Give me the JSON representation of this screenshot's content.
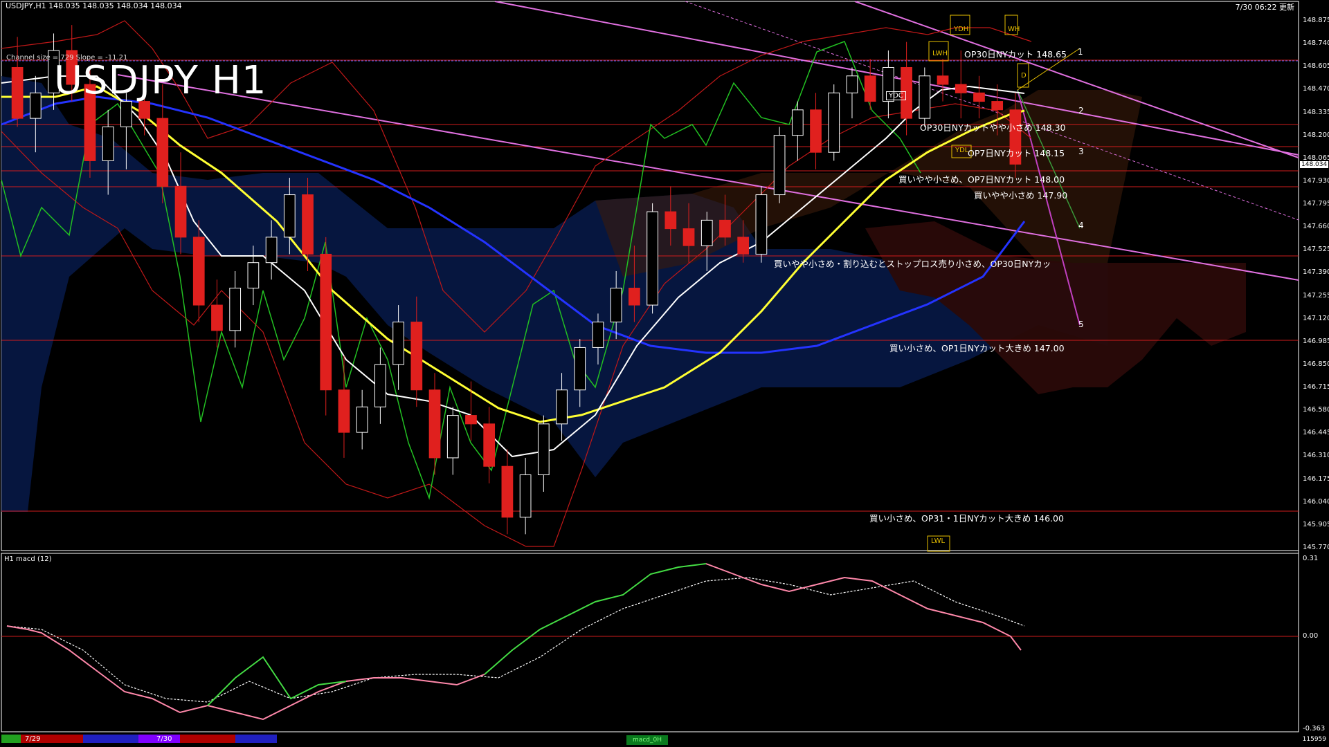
{
  "header": {
    "symbol_info": "USDJPY,H1  148.035 148.035 148.034 148.034",
    "datetime": "7/30 06:22 更新",
    "big_title": "USDJPY H1",
    "channel_info": "Channel size = 729 Slope = -11.21"
  },
  "macd_panel": {
    "title": "H1  macd (12)",
    "axis_labels": [
      "0.31",
      "0.00",
      "-0.363"
    ]
  },
  "bottom_bar": {
    "dates": [
      "7/29",
      "7/30"
    ],
    "tab_label": "macd_0H",
    "volume": "115959"
  },
  "yaxis": {
    "ticks": [
      "148.875",
      "148.740",
      "148.605",
      "148.470",
      "148.335",
      "148.200",
      "148.065",
      "147.930",
      "147.795",
      "147.660",
      "147.525",
      "147.390",
      "147.255",
      "147.120",
      "146.985",
      "146.850",
      "146.715",
      "146.580",
      "146.445",
      "146.310",
      "146.175",
      "146.040",
      "145.905",
      "145.770"
    ],
    "current_price": "148.034"
  },
  "levels": [
    {
      "text": "OP30日NYカット 148.65",
      "color": "#d01c1c"
    },
    {
      "text": "OP30日NYカットやや小さめ 148.30",
      "color": "#d01c1c"
    },
    {
      "text": "OP7日NYカット 148.15",
      "color": "#d01c1c"
    },
    {
      "text": "買いやや小さめ、OP7日NYカット 148.00",
      "color": "#d01c1c"
    },
    {
      "text": "買いやや小さめ 147.90",
      "color": "#d01c1c"
    },
    {
      "text": "買いやや小さめ・割り込むとストップロス売り小さめ、OP30日NYカッ",
      "color": "#d01c1c"
    },
    {
      "text": "買い小さめ、OP1日NYカット大きめ 147.00",
      "color": "#d01c1c"
    },
    {
      "text": "買い小さめ、OP31・1日NYカット大きめ 146.00",
      "color": "#d01c1c"
    }
  ],
  "channel_numbers": [
    "1",
    "2",
    "3",
    "4",
    "5"
  ],
  "boxes": [
    "YDH",
    "WH",
    "LWH",
    "D",
    "YDC",
    "YDL",
    "LWL"
  ],
  "colors": {
    "bull": "#ffffff",
    "bear": "#e0201e",
    "sma_white": "#ffffff",
    "sma_yellow": "#ffff33",
    "sma_blue": "#2433ff",
    "chikou": "#22c022",
    "bollinger": "#c01818",
    "channel": "#e070e0",
    "macd_up": "#44dd44",
    "macd_down": "#ff88aa"
  },
  "chart_data": {
    "type": "candlestick",
    "symbol": "USDJPY",
    "timeframe": "H1",
    "ylim": [
      145.77,
      148.875
    ],
    "candles": [
      [
        148.6,
        148.78,
        148.25,
        148.3
      ],
      [
        148.3,
        148.55,
        148.1,
        148.45
      ],
      [
        148.45,
        148.8,
        148.35,
        148.7
      ],
      [
        148.7,
        148.85,
        148.4,
        148.5
      ],
      [
        148.5,
        148.6,
        147.95,
        148.05
      ],
      [
        148.05,
        148.35,
        147.85,
        148.25
      ],
      [
        148.25,
        148.45,
        148.0,
        148.4
      ],
      [
        148.4,
        148.55,
        148.2,
        148.3
      ],
      [
        148.3,
        148.5,
        147.8,
        147.9
      ],
      [
        147.9,
        148.1,
        147.5,
        147.6
      ],
      [
        147.6,
        147.7,
        147.1,
        147.2
      ],
      [
        147.2,
        147.35,
        146.95,
        147.05
      ],
      [
        147.05,
        147.4,
        146.95,
        147.3
      ],
      [
        147.3,
        147.55,
        147.2,
        147.45
      ],
      [
        147.45,
        147.7,
        147.35,
        147.6
      ],
      [
        147.6,
        147.95,
        147.5,
        147.85
      ],
      [
        147.85,
        147.95,
        147.4,
        147.5
      ],
      [
        147.5,
        147.6,
        146.55,
        146.7
      ],
      [
        146.7,
        146.9,
        146.3,
        146.45
      ],
      [
        146.45,
        146.7,
        146.35,
        146.6
      ],
      [
        146.6,
        146.95,
        146.5,
        146.85
      ],
      [
        146.85,
        147.2,
        146.7,
        147.1
      ],
      [
        147.1,
        147.25,
        146.6,
        146.7
      ],
      [
        146.7,
        146.8,
        146.2,
        146.3
      ],
      [
        146.3,
        146.6,
        146.2,
        146.55
      ],
      [
        146.55,
        146.75,
        146.4,
        146.5
      ],
      [
        146.5,
        146.6,
        146.15,
        146.25
      ],
      [
        146.25,
        146.35,
        145.85,
        145.95
      ],
      [
        145.95,
        146.3,
        145.85,
        146.2
      ],
      [
        146.2,
        146.55,
        146.1,
        146.5
      ],
      [
        146.5,
        146.8,
        146.4,
        146.7
      ],
      [
        146.7,
        147.0,
        146.6,
        146.95
      ],
      [
        146.95,
        147.15,
        146.85,
        147.1
      ],
      [
        147.1,
        147.4,
        147.0,
        147.3
      ],
      [
        147.3,
        147.55,
        147.1,
        147.2
      ],
      [
        147.2,
        147.8,
        147.15,
        147.75
      ],
      [
        147.75,
        147.9,
        147.55,
        147.65
      ],
      [
        147.65,
        147.8,
        147.45,
        147.55
      ],
      [
        147.55,
        147.75,
        147.4,
        147.7
      ],
      [
        147.7,
        147.85,
        147.55,
        147.6
      ],
      [
        147.6,
        147.7,
        147.45,
        147.5
      ],
      [
        147.5,
        147.9,
        147.45,
        147.85
      ],
      [
        147.85,
        148.25,
        147.8,
        148.2
      ],
      [
        148.2,
        148.4,
        148.05,
        148.35
      ],
      [
        148.35,
        148.45,
        148.0,
        148.1
      ],
      [
        148.1,
        148.5,
        148.05,
        148.45
      ],
      [
        148.45,
        148.6,
        148.3,
        148.55
      ],
      [
        148.55,
        148.65,
        148.35,
        148.4
      ],
      [
        148.4,
        148.7,
        148.3,
        148.6
      ],
      [
        148.6,
        148.75,
        148.2,
        148.3
      ],
      [
        148.3,
        148.6,
        148.25,
        148.55
      ],
      [
        148.55,
        148.65,
        148.4,
        148.5
      ],
      [
        148.5,
        148.7,
        148.3,
        148.45
      ],
      [
        148.45,
        148.55,
        148.3,
        148.4
      ],
      [
        148.4,
        148.5,
        148.2,
        148.35
      ],
      [
        148.35,
        148.45,
        147.95,
        148.03
      ]
    ],
    "macd_range": [
      -0.363,
      0.31
    ]
  }
}
